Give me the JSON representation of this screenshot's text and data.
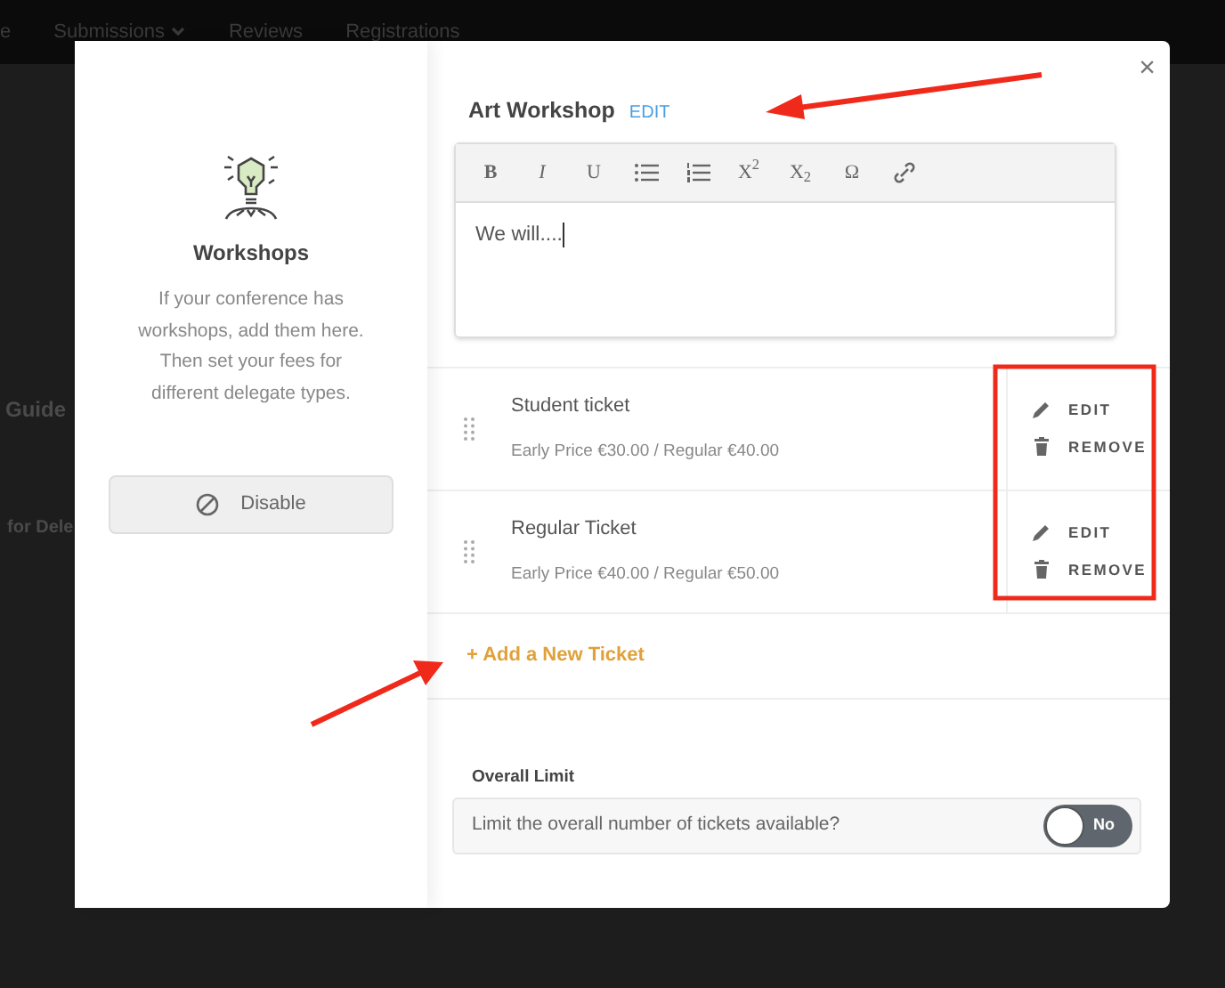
{
  "nav": {
    "items": [
      {
        "label": "e",
        "dropdown": false
      },
      {
        "label": "Submissions",
        "dropdown": true
      },
      {
        "label": "Reviews",
        "dropdown": false
      },
      {
        "label": "Registrations",
        "dropdown": false
      }
    ]
  },
  "background_texts": [
    "Guide",
    "for Dele"
  ],
  "modal": {
    "close": "×",
    "sidebar": {
      "title": "Workshops",
      "description": "If your conference has workshops, add them here. Then set your fees for different delegate types.",
      "button": "Disable"
    },
    "workshop": {
      "title": "Art Workshop",
      "edit_link": "EDIT"
    },
    "editor": {
      "toolbar": [
        {
          "kind": "bold",
          "label": "B"
        },
        {
          "kind": "italic",
          "label": "I"
        },
        {
          "kind": "text",
          "label": "U"
        },
        {
          "kind": "bullets"
        },
        {
          "kind": "numbers"
        },
        {
          "kind": "text",
          "label": "X$^{2}$"
        },
        {
          "kind": "text",
          "label": "X$_{2}$"
        },
        {
          "kind": "text",
          "label": "Ω"
        },
        {
          "kind": "link"
        }
      ],
      "value": "We will...."
    },
    "tickets": [
      {
        "name": "Student ticket",
        "prices": "Early Price €30.00 / Regular €40.00",
        "edit": "EDIT",
        "remove": "REMOVE"
      },
      {
        "name": "Regular Ticket",
        "prices": "Early Price €40.00 / Regular €50.00",
        "edit": "EDIT",
        "remove": "REMOVE"
      }
    ],
    "add_ticket": "+ Add a New Ticket",
    "overall_limit": {
      "label": "Overall Limit",
      "question": "Limit the overall number of tickets available?",
      "on": false,
      "toggle_text": "No"
    }
  }
}
